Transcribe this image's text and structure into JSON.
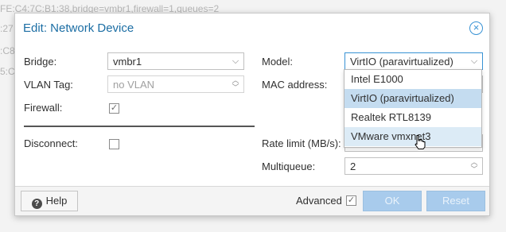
{
  "background": {
    "lines": [
      "FE:C4:7C:B1:38,bridge=vmbr1,firewall=1,queues=2",
      ":27",
      ":C8",
      "5:C8"
    ]
  },
  "dialog": {
    "title": "Edit: Network Device",
    "close_icon": "close-circle-icon",
    "fields": {
      "bridge_label": "Bridge:",
      "bridge_value": "vmbr1",
      "vlan_label": "VLAN Tag:",
      "vlan_placeholder": "no VLAN",
      "firewall_label": "Firewall:",
      "firewall_checked": true,
      "disconnect_label": "Disconnect:",
      "disconnect_checked": false,
      "model_label": "Model:",
      "model_value": "VirtIO (paravirtualized)",
      "mac_label": "MAC address:",
      "rate_label": "Rate limit (MB/s):",
      "multiqueue_label": "Multiqueue:",
      "multiqueue_value": "2"
    },
    "model_options": [
      "Intel E1000",
      "VirtIO (paravirtualized)",
      "Realtek RTL8139",
      "VMware vmxnet3"
    ],
    "footer": {
      "help_label": "Help",
      "advanced_label": "Advanced",
      "advanced_checked": true,
      "ok_label": "OK",
      "reset_label": "Reset"
    }
  },
  "colors": {
    "title": "#1c6ea4",
    "accent": "#3892d4",
    "primary_button": "#a8cbec",
    "selected_option": "#c4dcf0",
    "hover_option": "#dcebf6"
  }
}
